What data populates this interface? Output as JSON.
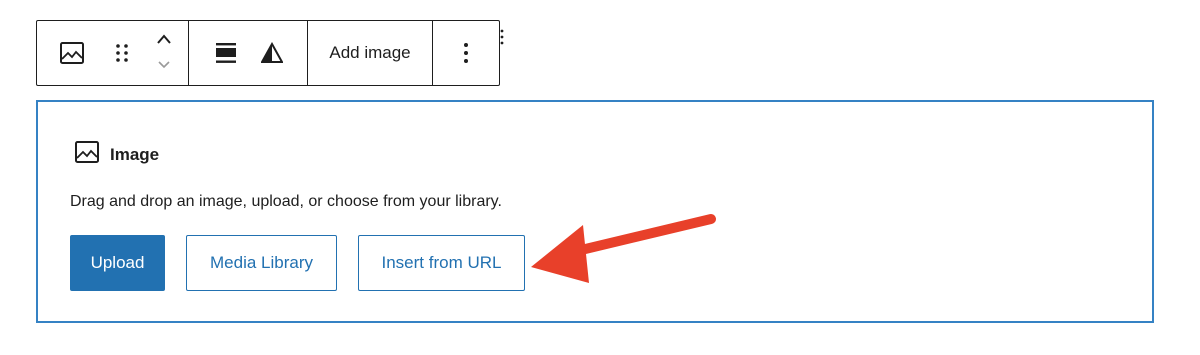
{
  "toolbar": {
    "tools": [
      {
        "icon": "image-icon"
      },
      {
        "icon": "drag-handle-icon"
      },
      {
        "icon": "move-up-down-icon"
      },
      {
        "icon": "align-icon"
      },
      {
        "icon": "filter-icon"
      }
    ],
    "add_image_label": "Add image",
    "more_icon": "more-options-icon"
  },
  "block": {
    "title": "Image",
    "instructions": "Drag and drop an image, upload, or choose from your library.",
    "buttons": {
      "upload": "Upload",
      "media_library": "Media Library",
      "insert_url": "Insert from URL"
    }
  },
  "colors": {
    "accent": "#2271b1",
    "focus_border": "#3582c4",
    "annotation_arrow": "#e8402a",
    "text": "#1e1e1e"
  }
}
